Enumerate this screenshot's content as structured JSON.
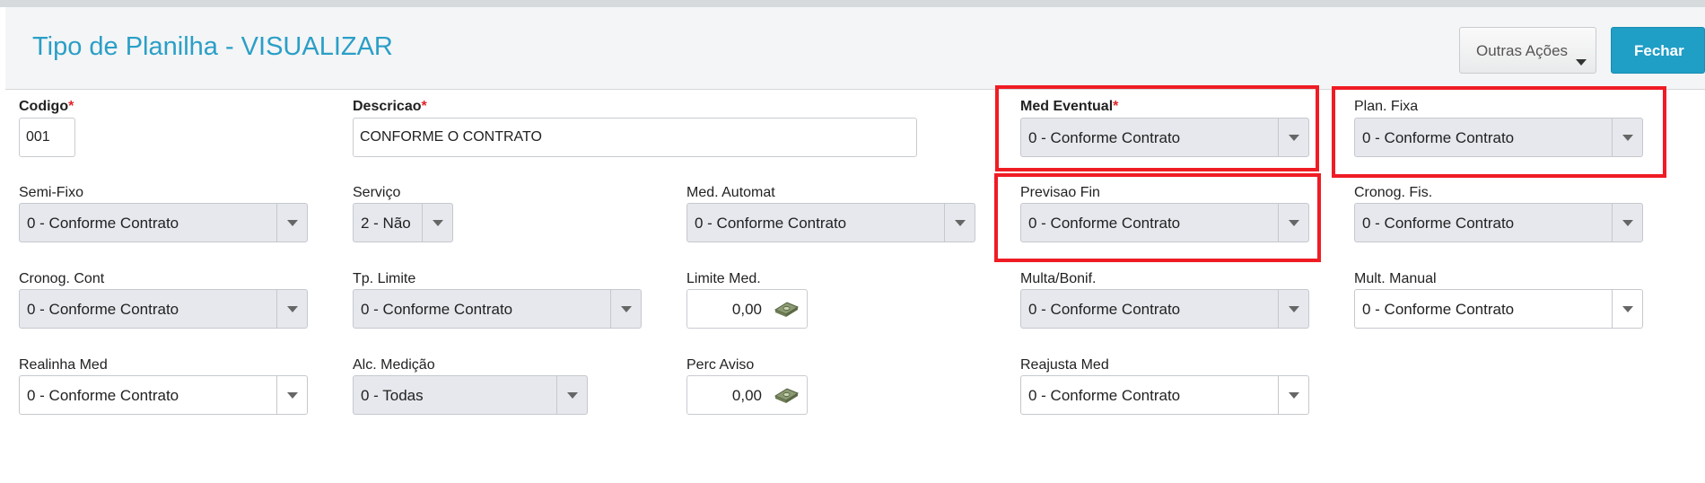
{
  "header": {
    "title": "Tipo de Planilha - VISUALIZAR",
    "outras_acoes_label": "Outras Ações",
    "fechar_label": "Fechar"
  },
  "required_marker": "*",
  "fields": {
    "codigo": {
      "label": "Codigo",
      "value": "001"
    },
    "descricao": {
      "label": "Descricao",
      "value": "CONFORME O CONTRATO"
    },
    "med_eventual": {
      "label": "Med Eventual",
      "value": "0 - Conforme Contrato"
    },
    "plan_fixa": {
      "label": "Plan. Fixa",
      "value": "0 - Conforme Contrato"
    },
    "semi_fixo": {
      "label": "Semi-Fixo",
      "value": "0 - Conforme Contrato"
    },
    "servico": {
      "label": "Serviço",
      "value": "2 - Não"
    },
    "med_automat": {
      "label": "Med. Automat",
      "value": "0 - Conforme Contrato"
    },
    "previsao_fin": {
      "label": "Previsao Fin",
      "value": "0 - Conforme Contrato"
    },
    "cronog_fis": {
      "label": "Cronog. Fis.",
      "value": "0 - Conforme Contrato"
    },
    "cronog_cont": {
      "label": "Cronog. Cont",
      "value": "0 - Conforme Contrato"
    },
    "tp_limite": {
      "label": "Tp. Limite",
      "value": "0 - Conforme Contrato"
    },
    "limite_med": {
      "label": "Limite Med.",
      "value": "0,00"
    },
    "multa_bonif": {
      "label": "Multa/Bonif.",
      "value": "0 - Conforme Contrato"
    },
    "mult_manual": {
      "label": "Mult. Manual",
      "value": "0 - Conforme Contrato"
    },
    "realinha_med": {
      "label": "Realinha Med",
      "value": "0 - Conforme Contrato"
    },
    "alc_medicao": {
      "label": "Alc. Medição",
      "value": "0 - Todas"
    },
    "perc_aviso": {
      "label": "Perc Aviso",
      "value": "0,00"
    },
    "reajusta_med": {
      "label": "Reajusta Med",
      "value": "0 - Conforme Contrato"
    }
  },
  "icons": {
    "dropdown": "chevron-down-icon",
    "currency": "money-icon"
  },
  "colors": {
    "title": "#2a9fc7",
    "primary_button": "#1f9ec6",
    "required": "#e0242b",
    "highlight": "#ef1c24",
    "readonly_field": "#e6e8ed"
  }
}
